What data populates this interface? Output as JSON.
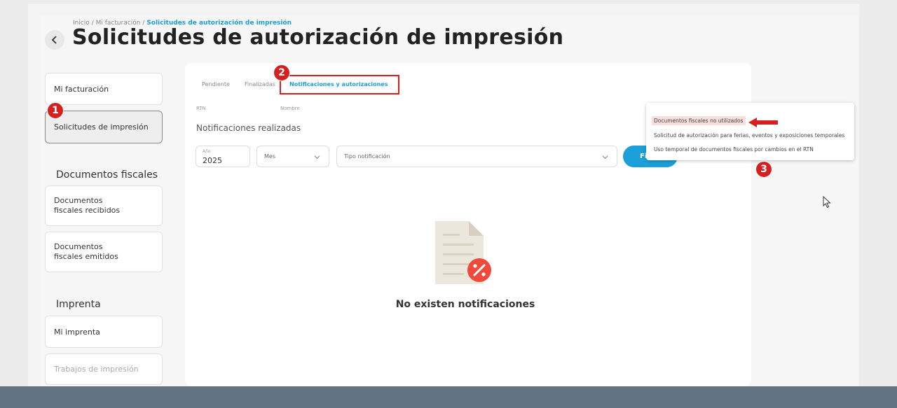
{
  "breadcrumb": {
    "home": "Inicio",
    "sep": "/",
    "billing": "Mi facturación",
    "current": "Solicitudes de autorización de impresión"
  },
  "page_title": "Solicitudes de autorización de impresión",
  "sidebar": {
    "items": [
      {
        "label": "Mi facturación"
      },
      {
        "label": "Solicitudes de impresión"
      }
    ],
    "docs_section": "Documentos fiscales",
    "docs_items": [
      {
        "label": "Documentos fiscales recibidos"
      },
      {
        "label": "Documentos fiscales emitidos"
      }
    ],
    "print_section": "Imprenta",
    "print_items": [
      {
        "label": "Mi imprenta"
      },
      {
        "label": "Trabajos de impresión"
      }
    ]
  },
  "tabs": [
    {
      "label": "Pendiente"
    },
    {
      "label": "Finalizadas"
    },
    {
      "label": "Notificaciones y autorizaciones"
    }
  ],
  "labels": {
    "rtn": "RTN",
    "nombre": "Nombre"
  },
  "section_subtitle": "Notificaciones realizadas",
  "filters": {
    "year_label": "Año",
    "year_value": "2025",
    "month_placeholder": "Mes",
    "type_placeholder": "Tipo notificación",
    "filter_button": "Fi"
  },
  "empty_state": {
    "message": "No existen notificaciones"
  },
  "dropdown": {
    "options": [
      "Documentos fiscales no utilizados",
      "Solicitud de autorización para ferias, eventos y exposiciones temporales",
      "Uso temporal de documentos fiscales por cambios en el RTN"
    ]
  },
  "annotations": {
    "step1": "1",
    "step2": "2",
    "step3": "3"
  },
  "colors": {
    "accent": "#1a9fd8",
    "annotation_red": "#d62020",
    "empty_icon_badge": "#ef4a3c"
  }
}
